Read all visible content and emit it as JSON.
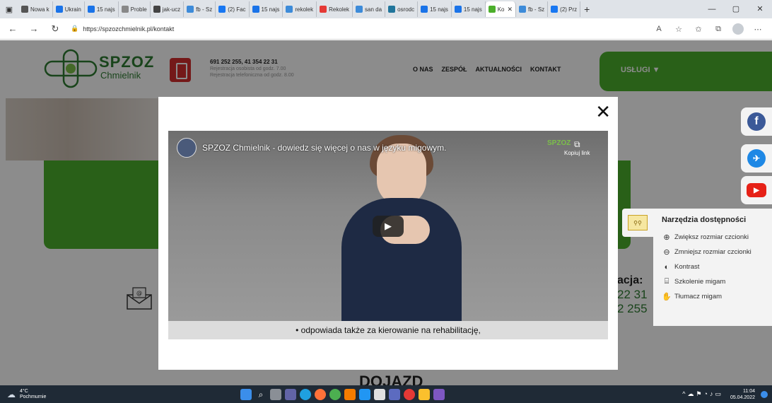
{
  "browser": {
    "tabs": [
      {
        "label": "Nowa k",
        "color": "#555"
      },
      {
        "label": "Ukrain",
        "color": "#1a73e8"
      },
      {
        "label": "15 najs",
        "color": "#1a73e8"
      },
      {
        "label": "Proble",
        "color": "#888"
      },
      {
        "label": "jak-ucz",
        "color": "#444"
      },
      {
        "label": "fb - Sz",
        "color": "#3d8bd9"
      },
      {
        "label": "(2) Fac",
        "color": "#1877f2"
      },
      {
        "label": "15 najs",
        "color": "#1a73e8"
      },
      {
        "label": "rekolek",
        "color": "#3d8bd9"
      },
      {
        "label": "Rekolek",
        "color": "#e53935"
      },
      {
        "label": "san da",
        "color": "#3d8bd9"
      },
      {
        "label": "osrodc",
        "color": "#21759b"
      },
      {
        "label": "15 najs",
        "color": "#1a73e8"
      },
      {
        "label": "15 najs",
        "color": "#1a73e8"
      },
      {
        "label": "Ko",
        "color": "#4caf2c",
        "active": true
      },
      {
        "label": "fb - Sz",
        "color": "#3d8bd9"
      },
      {
        "label": "(2) Prz",
        "color": "#1877f2"
      }
    ],
    "url": "https://spzozchmielnik.pl/kontakt"
  },
  "header": {
    "logo_main": "SPZOZ",
    "logo_sub": "Chmielnik",
    "phones": "691 252 255, 41 354 22 31",
    "reg1": "Rejestracja osobista od godz. 7.00",
    "reg2": "Rejestracja telefoniczna od godz. 8.00",
    "nav": [
      "O NAS",
      "ZESPÓŁ",
      "AKTUALNOŚCI",
      "KONTAKT"
    ],
    "services": "USŁUGI ▼"
  },
  "contact": {
    "label": "acja:",
    "line1": "22 31",
    "line2": "2 255"
  },
  "section_title": "DOJAZD",
  "modal": {
    "close": "✕",
    "video_title": "SPZOZ Chmielnik - dowiedz się więcej o nas w języku migowym.",
    "watermark": "SPZOZ",
    "copy_link": "Kopiuj link",
    "subtitle": "• odpowiada także za kierowanie na rehabilitację,"
  },
  "accessibility": {
    "title": "Narzędzia dostępności",
    "items": [
      {
        "icon": "zoom-in-icon",
        "glyph": "⊕",
        "label": "Zwiększ rozmiar czcionki"
      },
      {
        "icon": "zoom-out-icon",
        "glyph": "⊖",
        "label": "Zmniejsz rozmiar czcionki"
      },
      {
        "icon": "contrast-icon",
        "glyph": "◐",
        "label": "Kontrast"
      },
      {
        "icon": "training-icon",
        "glyph": "⌸",
        "label": "Szkolenie migam"
      },
      {
        "icon": "translator-icon",
        "glyph": "✋",
        "label": "Tłumacz migam"
      }
    ]
  },
  "taskbar": {
    "temp": "4°C",
    "weather": "Pochmurnie",
    "time": "11:04",
    "date": "05.04.2022"
  },
  "colors": {
    "brand_green": "#4caf2c",
    "logo_green": "#2f7d32",
    "phone_red": "#d32f2f",
    "facebook": "#1877f2",
    "youtube": "#e62117"
  }
}
